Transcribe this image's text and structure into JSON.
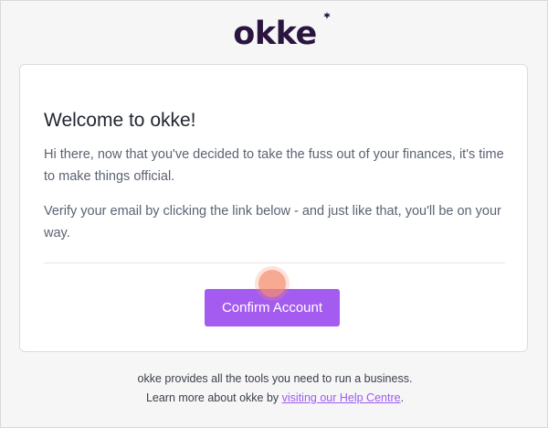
{
  "brand": {
    "logo_text": "okke",
    "logo_color": "#2a1540"
  },
  "email": {
    "title": "Welcome to okke!",
    "paragraph_1": "Hi there, now that you've decided to take the fuss out of your finances, it's time to make things official.",
    "paragraph_2": "Verify your email by clicking the link below - and just like that, you'll be on your way.",
    "cta_label": "Confirm Account",
    "cta_color": "#a45bf0"
  },
  "footer": {
    "line_1": "okke provides all the tools you need to run a business.",
    "line_2_prefix": "Learn more about okke by ",
    "help_link_text": "visiting our Help Centre",
    "line_2_suffix": ".",
    "link_color": "#9b5cf0"
  }
}
